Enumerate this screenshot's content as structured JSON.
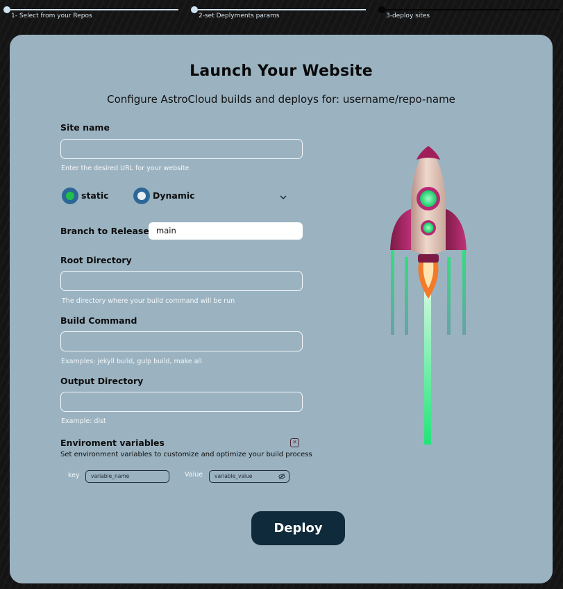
{
  "stepper": {
    "steps": [
      {
        "label": "1- Select from your Repos",
        "state": "complete"
      },
      {
        "label": "2-set Deplyments params",
        "state": "complete"
      },
      {
        "label": "3-deploy sites",
        "state": "current"
      }
    ]
  },
  "header": {
    "title": "Launch Your Website",
    "subtitle": "Configure AstroCloud builds and deploys for: username/repo-name"
  },
  "form": {
    "site_name": {
      "label": "Site name",
      "value": "",
      "hint": "Enter the desired URL for your website"
    },
    "site_type": {
      "options": [
        {
          "label": "static",
          "selected": true
        },
        {
          "label": "Dynamic",
          "selected": false
        }
      ]
    },
    "branch": {
      "label": "Branch to Release",
      "value": "main"
    },
    "root_directory": {
      "label": "Root Directory",
      "value": "",
      "hint": "The directory where your build command will be run"
    },
    "build_command": {
      "label": "Build Command",
      "value": "",
      "hint": "Examples: jekyll build, gulp build, make all"
    },
    "output_directory": {
      "label": "Output Directory",
      "value": "",
      "hint": "Example: dist"
    },
    "env": {
      "title": "Enviroment variables",
      "description": "Set environment variables to customize and optimize your build process",
      "key_label": "key",
      "key_placeholder": "variable_name",
      "value_label": "Value",
      "value_placeholder": "variable_value"
    }
  },
  "actions": {
    "deploy_label": "Deploy"
  },
  "colors": {
    "card": "#9bb3c1",
    "accent": "#2c6797",
    "deploy_button": "#0f2a3b",
    "radio_selected": "#1fbf4a"
  },
  "icons": [
    "chevron-down-icon",
    "close-icon",
    "eye-off-icon",
    "rocket-illustration"
  ]
}
